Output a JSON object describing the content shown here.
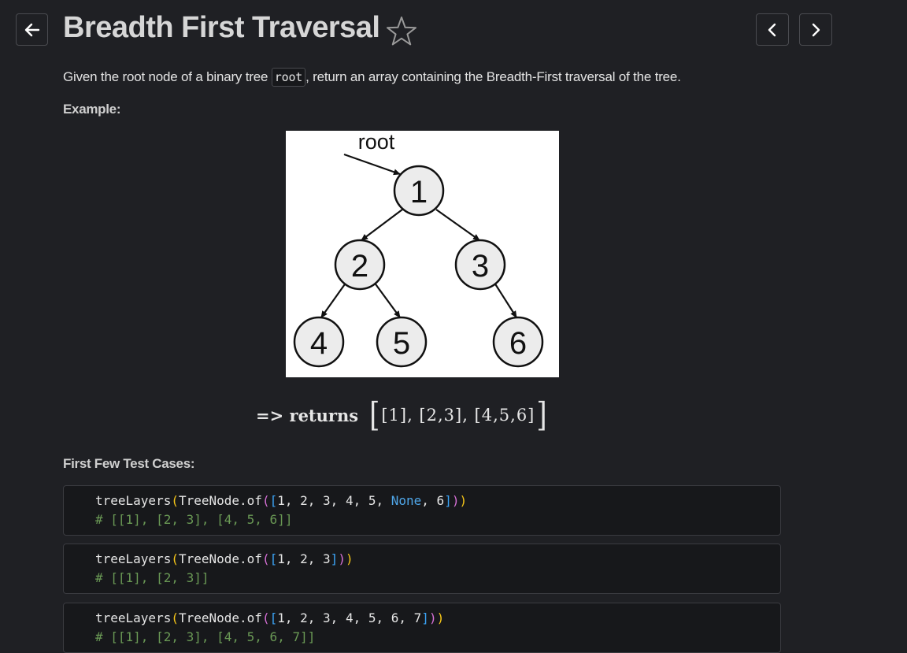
{
  "header": {
    "title": "Breadth First Traversal",
    "back_icon": "arrow-left-icon",
    "favorite_icon": "star-outline-icon",
    "prev_icon": "chevron-left-icon",
    "next_icon": "chevron-right-icon"
  },
  "description": {
    "before": "Given the root node of a binary tree ",
    "code": "root",
    "after": ", return an array containing the Breadth-First traversal of the tree."
  },
  "example_label": "Example:",
  "tree": {
    "pointer_label": "root",
    "nodes": [
      "1",
      "2",
      "3",
      "4",
      "5",
      "6"
    ]
  },
  "returns": {
    "prefix": "=> returns",
    "result": "[1], [2,3], [4,5,6]"
  },
  "test_cases_label": "First Few Test Cases:",
  "test_cases": [
    {
      "fn": "treeLayers",
      "cls": "TreeNode.of",
      "args": [
        "1",
        "2",
        "3",
        "4",
        "5",
        "None",
        "6"
      ],
      "comment": "# [[1], [2, 3], [4, 5, 6]]"
    },
    {
      "fn": "treeLayers",
      "cls": "TreeNode.of",
      "args": [
        "1",
        "2",
        "3"
      ],
      "comment": "# [[1], [2, 3]]"
    },
    {
      "fn": "treeLayers",
      "cls": "TreeNode.of",
      "args": [
        "1",
        "2",
        "3",
        "4",
        "5",
        "6",
        "7"
      ],
      "comment": "# [[1], [2, 3], [4, 5, 6, 7]]"
    }
  ],
  "colors": {
    "background": "#1f2024",
    "code_background": "#17181b",
    "paren_outer": "#f5c518",
    "paren_middle": "#d670d6",
    "bracket": "#3ba3f5",
    "keyword_none": "#4fa6e8",
    "comment": "#6a9955"
  }
}
